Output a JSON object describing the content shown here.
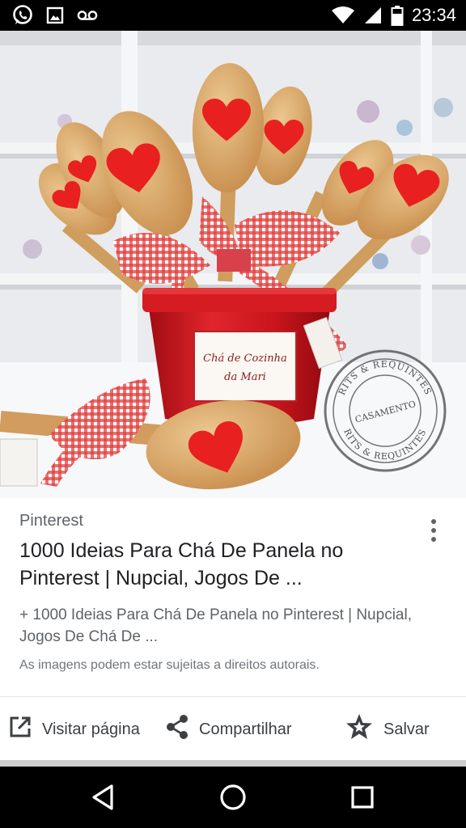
{
  "status_bar": {
    "time": "23:34",
    "icons": [
      "whatsapp-icon",
      "image-icon",
      "voicemail-icon",
      "wifi-icon",
      "cell-signal-icon",
      "battery-icon"
    ]
  },
  "image": {
    "pot_label_line1": "Chá de Cozinha",
    "pot_label_line2": "da Mari",
    "stamp_top": "RITS & REQUINTES",
    "stamp_center": "CASAMENTO",
    "stamp_bottom": "RITS & REQUINTES"
  },
  "result": {
    "source": "Pinterest",
    "title": "1000 Ideias Para Chá De Panela no Pinterest | Nupcial, Jogos De ...",
    "description": "+ 1000 Ideias Para Chá De Panela no Pinterest | Nupcial, Jogos De Chá De ...",
    "copyright": "As imagens podem estar sujeitas a direitos autorais."
  },
  "actions": {
    "visit": "Visitar página",
    "share": "Compartilhar",
    "save": "Salvar"
  },
  "colors": {
    "heart_red": "#e8201f",
    "pot_red": "#c8141b",
    "wood": "#d9a96a",
    "card_bg": "#ffffff",
    "text_primary": "#202124",
    "text_secondary": "#5f6368"
  }
}
